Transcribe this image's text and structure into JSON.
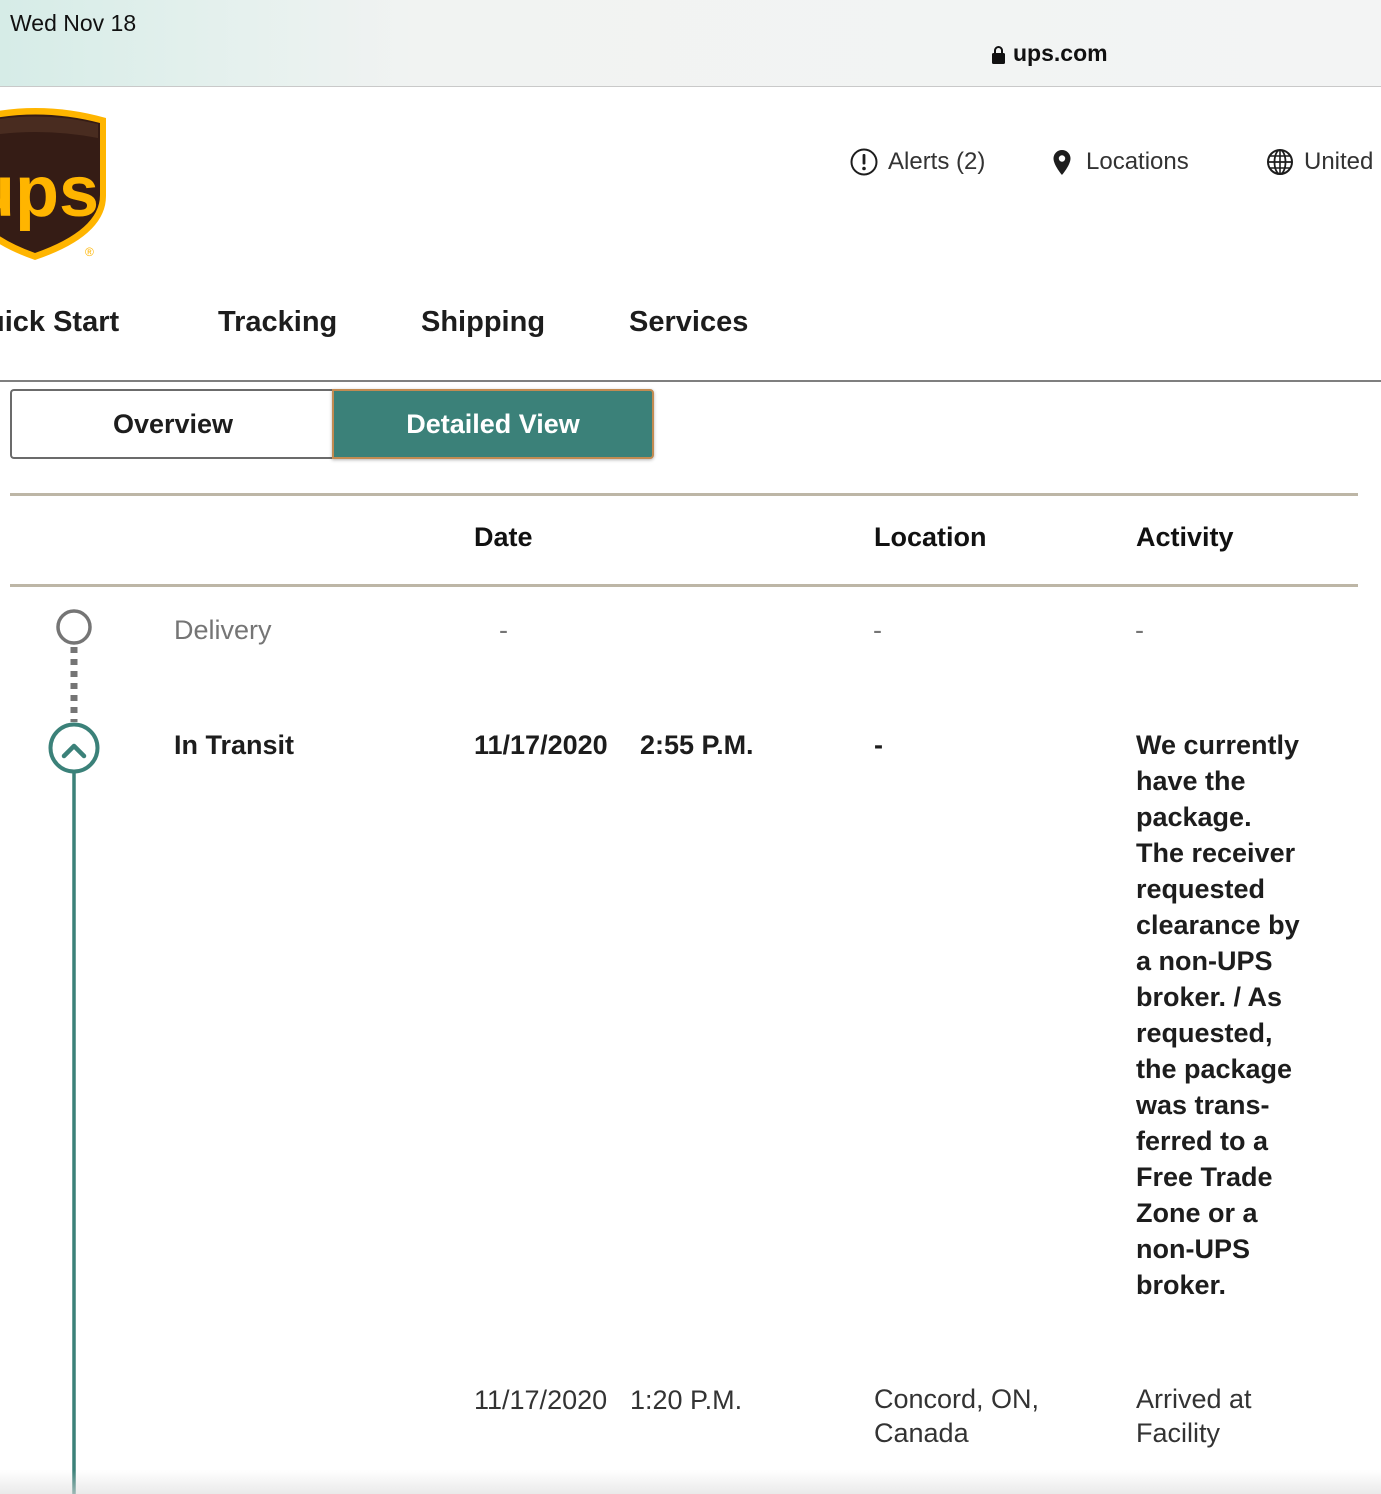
{
  "status_bar": {
    "time": "Wed Nov 18"
  },
  "address_bar": {
    "url": "ups.com",
    "lock_icon": "lock-icon"
  },
  "brand": {
    "logo_text": "ups",
    "registered_mark": "®",
    "colors": {
      "brown": "#351c15",
      "gold": "#ffb500"
    }
  },
  "utility_nav": {
    "alerts": {
      "icon": "alert-icon",
      "label": "Alerts (2)"
    },
    "locations": {
      "icon": "location-pin-icon",
      "label": "Locations"
    },
    "region": {
      "icon": "globe-icon",
      "label": "United"
    }
  },
  "main_nav": {
    "items": [
      {
        "label": "uick Start"
      },
      {
        "label": "Tracking"
      },
      {
        "label": "Shipping"
      },
      {
        "label": "Services"
      }
    ]
  },
  "view_toggle": {
    "overview_label": "Overview",
    "detailed_label": "Detailed View",
    "selected": "Detailed View",
    "accent_color": "#3b8179"
  },
  "table": {
    "headers": {
      "date": "Date",
      "location": "Location",
      "activity": "Activity"
    },
    "rows": [
      {
        "status": "Delivery",
        "date": "-",
        "location": "-",
        "activity": "-"
      },
      {
        "status": "In Transit",
        "date": "11/17/2020",
        "time": "2:55 P.M.",
        "location": "-",
        "activity_lines": [
          "We currently",
          "have the",
          "package.",
          "The receiver",
          "requested",
          "clearance by",
          "a non-UPS",
          "broker. / As",
          "requested,",
          "the package",
          "was trans-",
          "ferred to a",
          "Free Trade",
          "Zone or a",
          "non-UPS",
          "broker."
        ]
      },
      {
        "status": "",
        "date": "11/17/2020",
        "time": "1:20 P.M.",
        "location_lines": [
          "Concord, ON,",
          "Canada"
        ],
        "activity_lines": [
          "Arrived at",
          "Facility"
        ]
      }
    ]
  },
  "timeline": {
    "pending_icon": "empty-circle-icon",
    "current_icon": "chevron-up-icon",
    "line_color": "#3b8179"
  }
}
